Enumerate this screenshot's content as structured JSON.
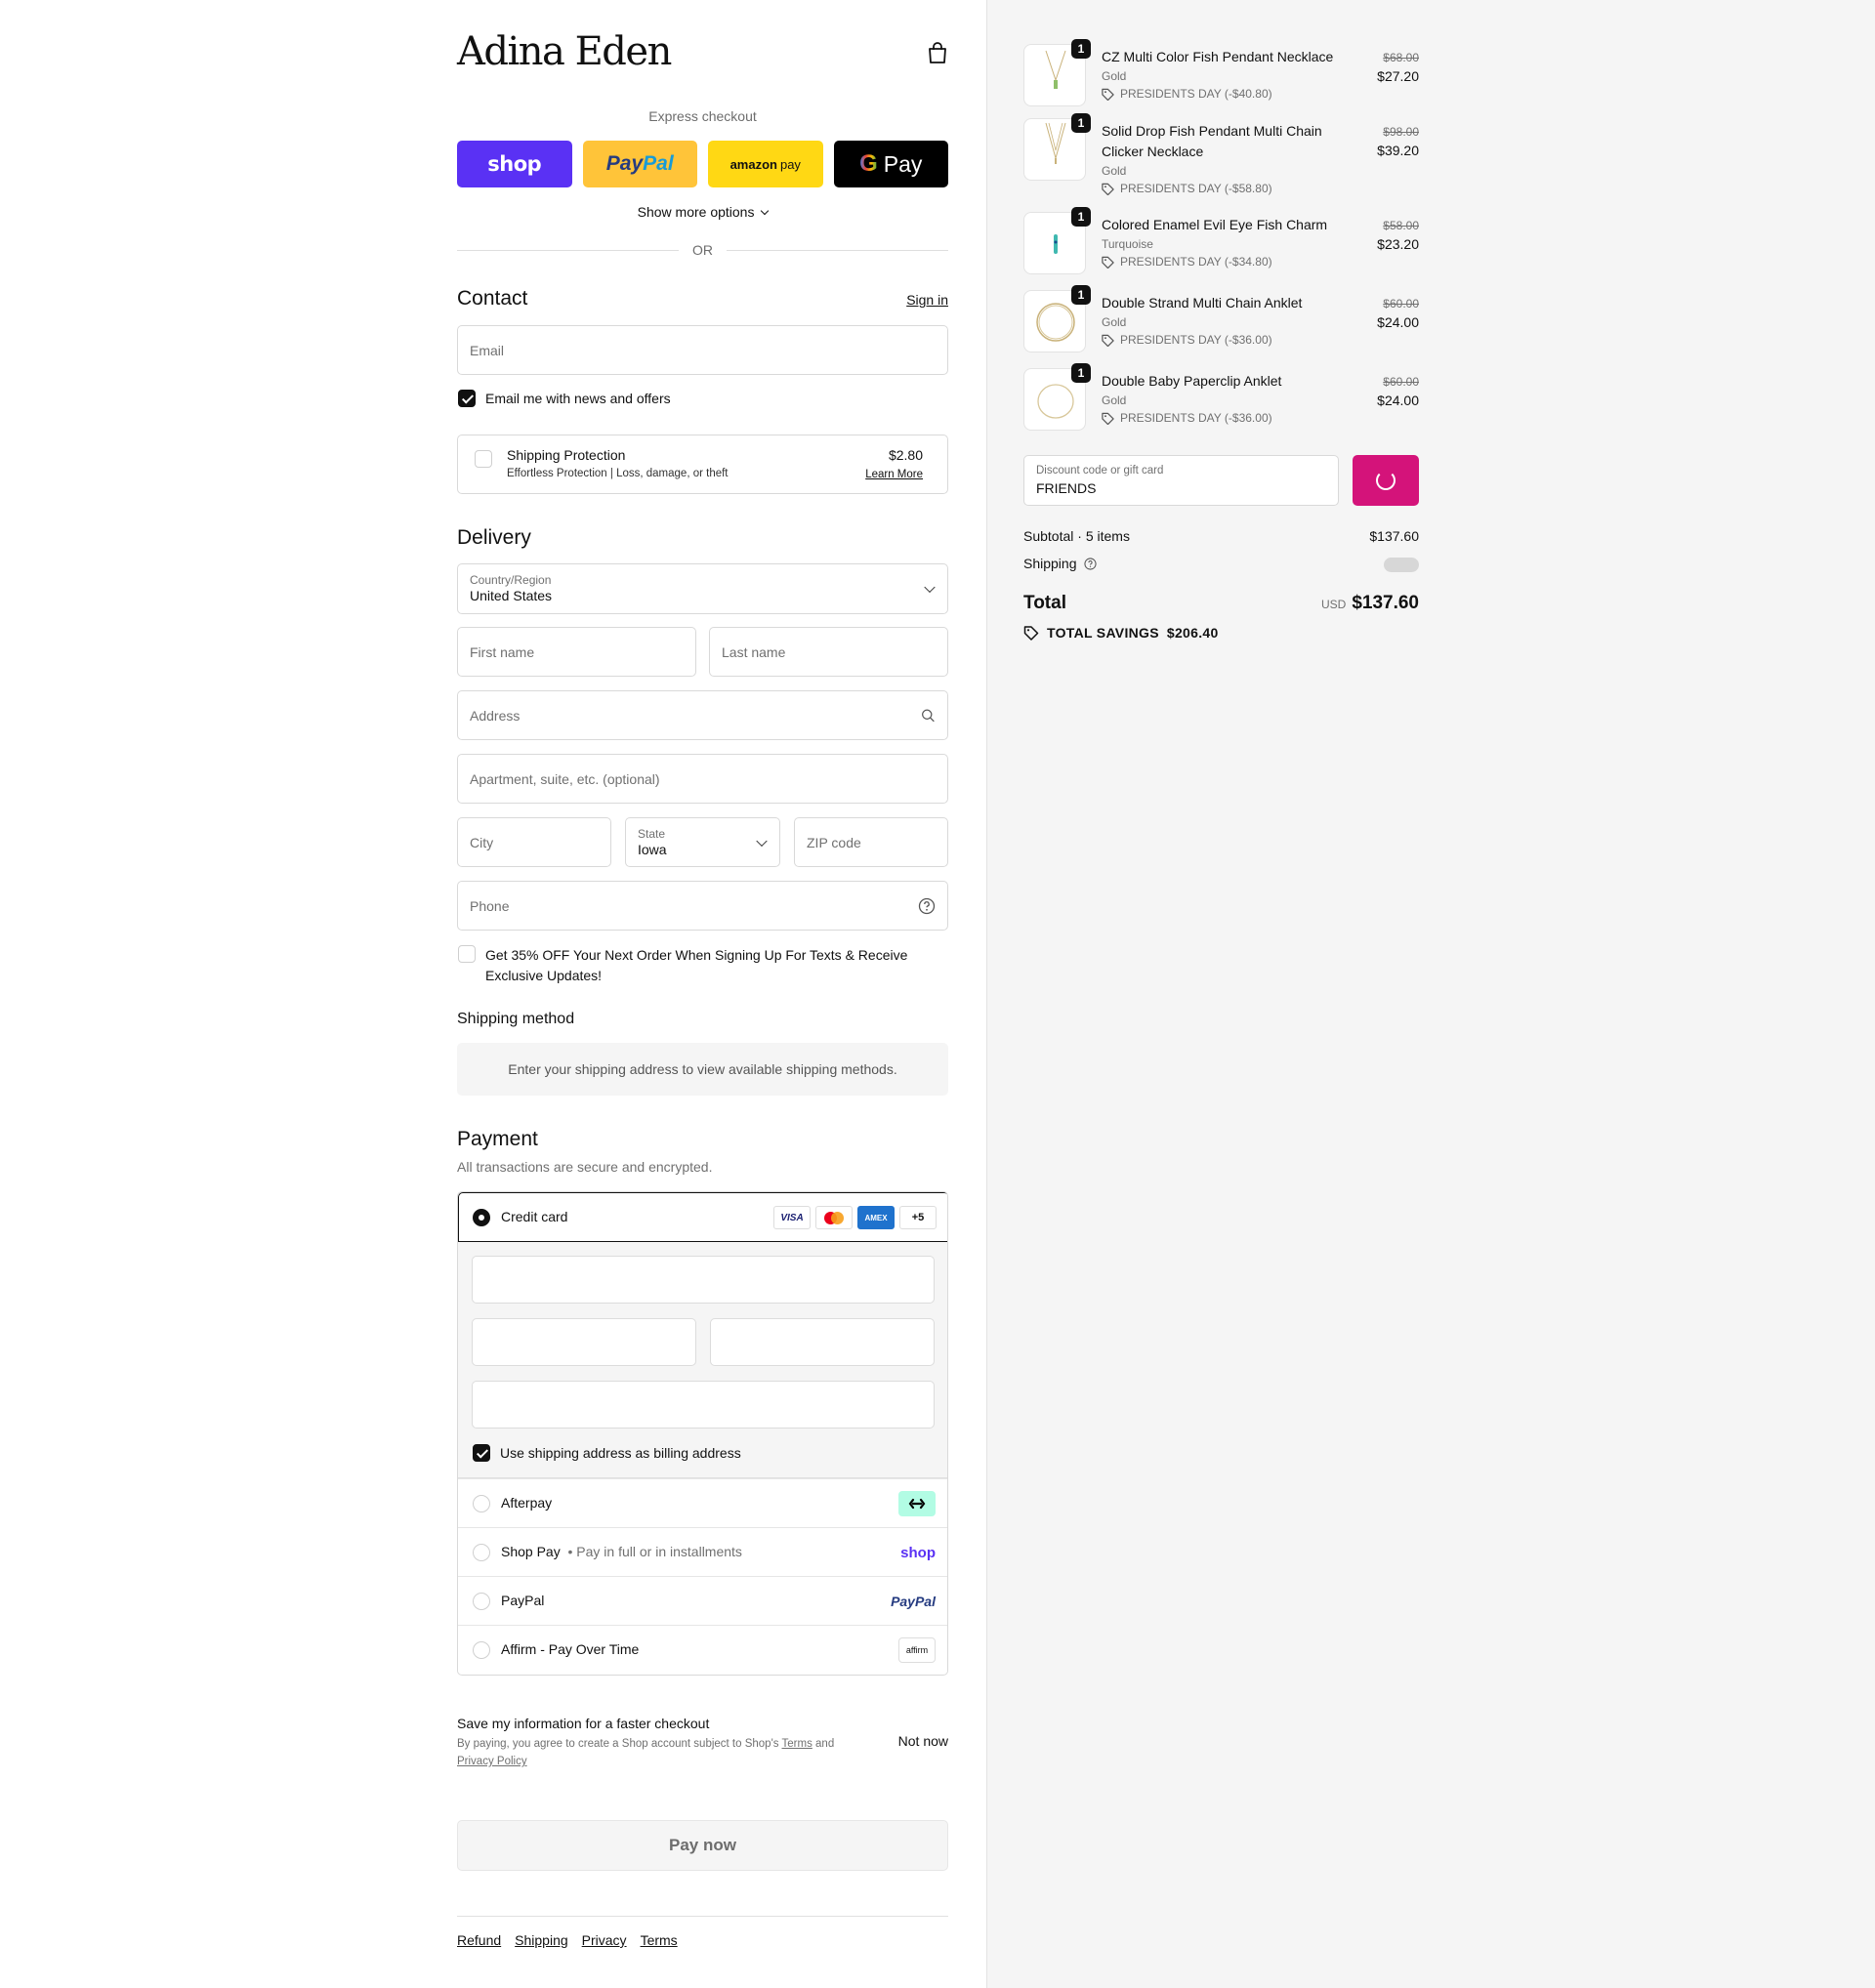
{
  "brand": {
    "logo_text": "Adina Eden"
  },
  "express": {
    "label": "Express checkout",
    "shop_label": "shop",
    "paypal_label_a": "Pay",
    "paypal_label_b": "Pal",
    "amazon_label_a": "amazon",
    "amazon_label_b": "pay",
    "gpay_label_g": "G",
    "gpay_label": "Pay",
    "more_options": "Show more options",
    "or": "OR"
  },
  "contact": {
    "heading": "Contact",
    "sign_in": "Sign in",
    "email_placeholder": "Email",
    "news_checkbox": "Email me with news and offers",
    "news_checked": true
  },
  "protection": {
    "title": "Shipping Protection",
    "subtitle": "Effortless Protection | Loss, damage, or theft",
    "price": "$2.80",
    "learn_more": "Learn More"
  },
  "delivery": {
    "heading": "Delivery",
    "country_label": "Country/Region",
    "country_value": "United States",
    "first_name": "First name",
    "last_name": "Last name",
    "address": "Address",
    "apartment": "Apartment, suite, etc. (optional)",
    "city": "City",
    "state_label": "State",
    "state_value": "Iowa",
    "zip": "ZIP code",
    "phone": "Phone",
    "sms_offer": "Get 35% OFF Your Next Order When Signing Up For Texts & Receive Exclusive Updates!"
  },
  "shipping_method": {
    "heading": "Shipping method",
    "message": "Enter your shipping address to view available shipping methods."
  },
  "payment": {
    "heading": "Payment",
    "subtitle": "All transactions are secure and encrypted.",
    "credit_card": "Credit card",
    "card_brands": [
      "VISA",
      "MC",
      "AMEX",
      "+5"
    ],
    "billing_same": "Use shipping address as billing address",
    "methods": [
      {
        "label": "Afterpay",
        "sub": "",
        "logo": "afterpay-logo"
      },
      {
        "label": "Shop Pay",
        "sub": "Pay in full or in installments",
        "logo": "shop"
      },
      {
        "label": "PayPal",
        "sub": "",
        "logo": "PayPal"
      },
      {
        "label": "Affirm - Pay Over Time",
        "sub": "",
        "logo": "affirm"
      }
    ]
  },
  "save_info": {
    "title": "Save my information for a faster checkout",
    "text_a": "By paying, you agree to create a Shop account subject to Shop's ",
    "terms": "Terms",
    "and": " and ",
    "privacy": "Privacy Policy",
    "not_now": "Not now"
  },
  "pay_now": "Pay now",
  "footer": [
    "Refund",
    "Shipping",
    "Privacy",
    "Terms"
  ],
  "cart": {
    "items": [
      {
        "name": "CZ Multi Color Fish Pendant Necklace",
        "variant": "Gold",
        "promo": "PRESIDENTS DAY (-$40.80)",
        "old": "$68.00",
        "new": "$27.20",
        "qty": "1"
      },
      {
        "name": "Solid Drop Fish Pendant Multi Chain Clicker Necklace",
        "variant": "Gold",
        "promo": "PRESIDENTS DAY (-$58.80)",
        "old": "$98.00",
        "new": "$39.20",
        "qty": "1"
      },
      {
        "name": "Colored Enamel Evil Eye Fish Charm",
        "variant": "Turquoise",
        "promo": "PRESIDENTS DAY (-$34.80)",
        "old": "$58.00",
        "new": "$23.20",
        "qty": "1"
      },
      {
        "name": "Double Strand Multi Chain Anklet",
        "variant": "Gold",
        "promo": "PRESIDENTS DAY (-$36.00)",
        "old": "$60.00",
        "new": "$24.00",
        "qty": "1"
      },
      {
        "name": "Double Baby Paperclip Anklet",
        "variant": "Gold",
        "promo": "PRESIDENTS DAY (-$36.00)",
        "old": "$60.00",
        "new": "$24.00",
        "qty": "1"
      }
    ],
    "discount_label": "Discount code or gift card",
    "discount_value": "FRIENDS",
    "subtotal_label": "Subtotal · 5 items",
    "subtotal_value": "$137.60",
    "shipping_label": "Shipping",
    "total_label": "Total",
    "currency": "USD",
    "total_value": "$137.60",
    "savings_label": "TOTAL SAVINGS",
    "savings_value": "$206.40"
  },
  "colors": {
    "shop_purple": "#5a31f4",
    "paypal_yellow": "#ffc439",
    "amazon_yellow": "#ffd814",
    "apply_pink": "#d4137a"
  }
}
